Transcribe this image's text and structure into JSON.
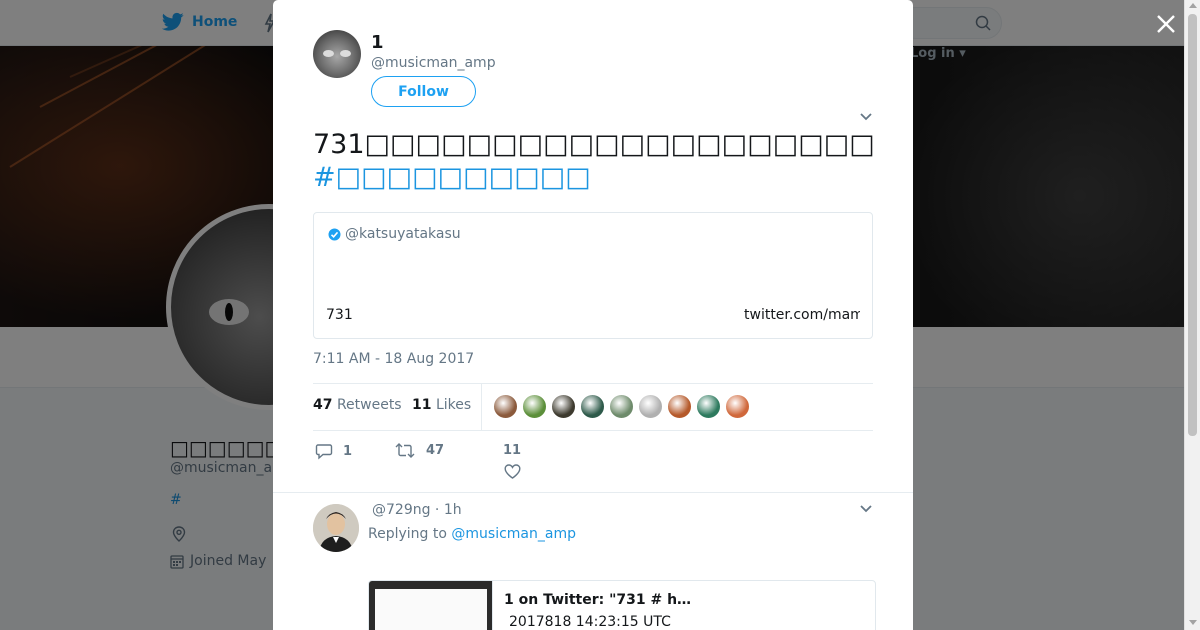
{
  "topbar": {
    "home_label": "Home",
    "login_label": "Log in"
  },
  "profile": {
    "name": "□□□□□□□□□",
    "handle": "@musicman_amp",
    "hashtag": "#",
    "joined": "Joined May"
  },
  "tweet": {
    "author_name": "1",
    "author_handle": "@musicman_amp",
    "follow_label": "Follow",
    "text": "731□□□□□□□□□□□□□□□□□□□□□□□□□□□□□□□",
    "hashtag": "#□□□□□□□□□□",
    "quote": {
      "user": "@katsuyatakasu",
      "body": "731",
      "link": "twitter.com/mam"
    },
    "timestamp": "7:11 AM - 18 Aug 2017",
    "retweets_count": "47",
    "retweets_label": "Retweets",
    "likes_count": "11",
    "likes_label": "Likes",
    "likers": [
      {
        "color": "#8b5a3c"
      },
      {
        "color": "#5c8f3a"
      },
      {
        "color": "#3d3a2e"
      },
      {
        "color": "#2e5a4a"
      },
      {
        "color": "#6e8b6b"
      },
      {
        "color": "#b0b0b0"
      },
      {
        "color": "#b5592a"
      },
      {
        "color": "#2d7a5e"
      },
      {
        "color": "#d0683b"
      }
    ],
    "actions": {
      "reply_count": "1",
      "retweet_count": "47",
      "like_count": "11"
    }
  },
  "reply": {
    "meta": "@729ng · 1h",
    "replying_prefix": "Replying to",
    "replying_to": "@musicman_amp",
    "card_title": "1 on Twitter: \"731 # h…",
    "card_desc": "2017818 14:23:15 UTC"
  },
  "colors": {
    "accent": "#1da1f2",
    "link": "#1b95e0",
    "text_secondary": "#657786"
  }
}
